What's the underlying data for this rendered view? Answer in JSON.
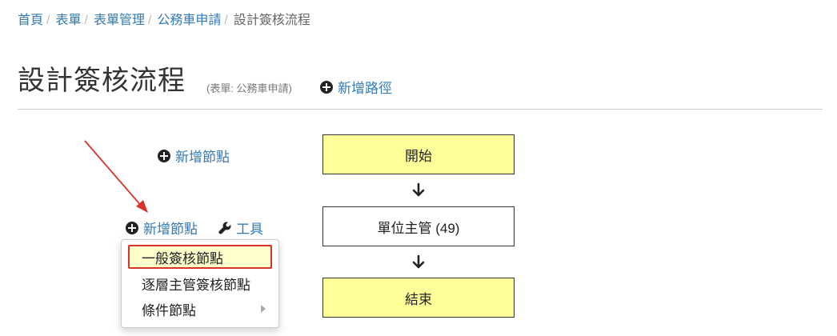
{
  "breadcrumb": [
    {
      "label": "首頁"
    },
    {
      "label": "表單"
    },
    {
      "label": "表單管理"
    },
    {
      "label": "公務車申請"
    },
    {
      "label": "設計簽核流程"
    }
  ],
  "breadcrumb_separator": "/",
  "page": {
    "title": "設計簽核流程",
    "subtitle": "(表單: 公務車申請)",
    "add_path_label": "新增路徑"
  },
  "actions": {
    "add_node_label": "新增節點",
    "tools_label": "工具"
  },
  "flow": {
    "nodes": [
      {
        "label": "開始",
        "style": "yellow"
      },
      {
        "label": "單位主管 (49)",
        "style": "white"
      },
      {
        "label": "結束",
        "style": "yellow"
      }
    ]
  },
  "menu": {
    "items": [
      {
        "label": "一般簽核節點",
        "highlighted": true
      },
      {
        "label": "逐層主管簽核節點"
      },
      {
        "label": "條件節點",
        "has_submenu": true
      }
    ]
  },
  "colors": {
    "link": "#337ab7",
    "node_fill": "#ffff99",
    "highlight_fill": "#ffffcc",
    "annotation_red": "#d9322a"
  }
}
